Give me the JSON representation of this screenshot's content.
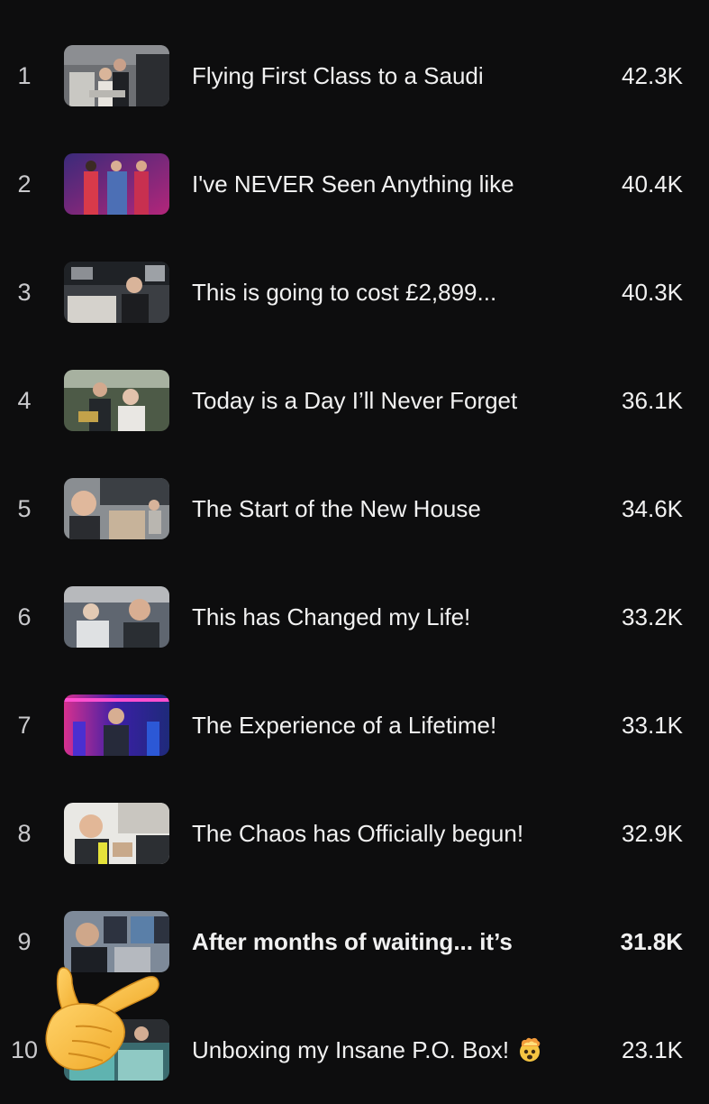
{
  "videos": [
    {
      "rank": "1",
      "title": "Flying First Class to a Saudi",
      "views": "42.3K",
      "thumb_colors": [
        "#6d6f73",
        "#c9c8c3",
        "#2b2d31"
      ]
    },
    {
      "rank": "2",
      "title": "I've NEVER Seen Anything like",
      "views": "40.4K",
      "thumb_colors": [
        "#b3267a",
        "#3a2a7a",
        "#d83a4a"
      ]
    },
    {
      "rank": "3",
      "title": "This is going to cost £2,899...",
      "views": "40.3K",
      "thumb_colors": [
        "#1f2226",
        "#8c8f94",
        "#d5d2cc"
      ]
    },
    {
      "rank": "4",
      "title": "Today is a Day I’ll Never Forget",
      "views": "36.1K",
      "thumb_colors": [
        "#4d5a47",
        "#a7b1a0",
        "#23272b"
      ]
    },
    {
      "rank": "5",
      "title": "The Start of the New House",
      "views": "34.6K",
      "thumb_colors": [
        "#8a8e92",
        "#c7b39a",
        "#3b3f44"
      ]
    },
    {
      "rank": "6",
      "title": "This has Changed my Life!",
      "views": "33.2K",
      "thumb_colors": [
        "#5f6670",
        "#b7b9bc",
        "#2a2e33"
      ]
    },
    {
      "rank": "7",
      "title": "The Experience of a Lifetime!",
      "views": "33.1K",
      "thumb_colors": [
        "#3b1fa6",
        "#d6308f",
        "#1e2a7a"
      ]
    },
    {
      "rank": "8",
      "title": "The Chaos has Officially begun!",
      "views": "32.9K",
      "thumb_colors": [
        "#e9e8e4",
        "#c8a98a",
        "#2c2f33"
      ]
    },
    {
      "rank": "9",
      "title": "After months of waiting... it’s",
      "views": "31.8K",
      "thumb_colors": [
        "#7e8a99",
        "#2d3340",
        "#cfa78a"
      ]
    },
    {
      "rank": "10",
      "title": "Unboxing my Insane P.O. Box!",
      "views": "23.1K",
      "thumb_colors": [
        "#3a6b6f",
        "#5fb3b0",
        "#2a2d31"
      ]
    }
  ],
  "icons": {
    "exploding_head": "exploding-head-emoji",
    "pointing_hand": "backhand-index-pointing-right-emoji"
  },
  "colors": {
    "background": "#0d0d0e",
    "text": "#f1f1f1",
    "rank_text": "#c9c9cc"
  }
}
